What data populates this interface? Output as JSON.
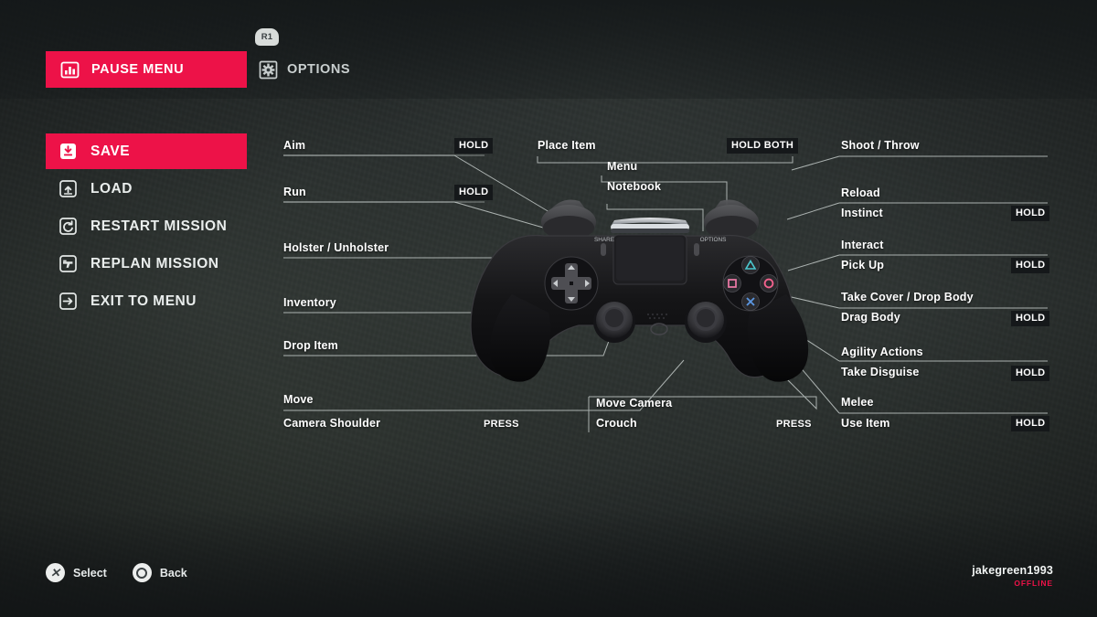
{
  "header": {
    "shoulder_badge": "R1",
    "tabs": [
      {
        "label": "PAUSE MENU",
        "icon": "chart-bars-icon",
        "active": true
      },
      {
        "label": "OPTIONS",
        "icon": "gear-icon",
        "active": false
      }
    ]
  },
  "sidebar": {
    "items": [
      {
        "label": "SAVE",
        "icon": "save-download-icon",
        "active": true
      },
      {
        "label": "LOAD",
        "icon": "load-upload-icon",
        "active": false
      },
      {
        "label": "RESTART MISSION",
        "icon": "restart-arrow-icon",
        "active": false
      },
      {
        "label": "REPLAN MISSION",
        "icon": "pistol-icon",
        "active": false
      },
      {
        "label": "EXIT TO MENU",
        "icon": "exit-arrow-icon",
        "active": false
      }
    ]
  },
  "controls": {
    "left": [
      {
        "label": "Aim",
        "tag": "HOLD",
        "tag_style": "box"
      },
      {
        "label": "Run",
        "tag": "HOLD",
        "tag_style": "box"
      },
      {
        "label": "Holster / Unholster",
        "tag": "",
        "tag_style": "none"
      },
      {
        "label": "Inventory",
        "tag": "",
        "tag_style": "none"
      },
      {
        "label": "Drop Item",
        "tag": "",
        "tag_style": "none"
      },
      {
        "label": "Move",
        "tag": "",
        "tag_style": "none"
      },
      {
        "label": "Camera Shoulder",
        "tag": "PRESS",
        "tag_style": "plain"
      }
    ],
    "center": [
      {
        "label": "Place Item",
        "tag": "HOLD BOTH",
        "tag_style": "box"
      },
      {
        "label": "Menu",
        "tag": "",
        "tag_style": "none"
      },
      {
        "label": "Notebook",
        "tag": "",
        "tag_style": "none"
      },
      {
        "label": "Move Camera",
        "tag": "",
        "tag_style": "none"
      },
      {
        "label": "Crouch",
        "tag": "PRESS",
        "tag_style": "plain"
      }
    ],
    "right": [
      {
        "label": "Shoot / Throw",
        "tag": "",
        "tag_style": "none"
      },
      {
        "label": "Reload",
        "tag": "",
        "tag_style": "none"
      },
      {
        "label": "Instinct",
        "tag": "HOLD",
        "tag_style": "box"
      },
      {
        "label": "Interact",
        "tag": "",
        "tag_style": "none"
      },
      {
        "label": "Pick Up",
        "tag": "HOLD",
        "tag_style": "box"
      },
      {
        "label": "Take Cover / Drop Body",
        "tag": "",
        "tag_style": "none"
      },
      {
        "label": "Drag Body",
        "tag": "HOLD",
        "tag_style": "box"
      },
      {
        "label": "Agility Actions",
        "tag": "",
        "tag_style": "none"
      },
      {
        "label": "Take Disguise",
        "tag": "HOLD",
        "tag_style": "box"
      },
      {
        "label": "Melee",
        "tag": "",
        "tag_style": "none"
      },
      {
        "label": "Use Item",
        "tag": "HOLD",
        "tag_style": "box"
      }
    ]
  },
  "gamepad": {
    "share_label": "SHARE",
    "options_label": "OPTIONS",
    "buttons": {
      "triangle_color": "#4bc8cf",
      "circle_color": "#f2628d",
      "square_color": "#f07ba8",
      "cross_color": "#5b96e0"
    }
  },
  "footer": {
    "hints": [
      {
        "label": "Select",
        "icon": "cross-button-icon"
      },
      {
        "label": "Back",
        "icon": "circle-button-icon"
      }
    ],
    "user": {
      "name": "jakegreen1993",
      "status": "OFFLINE",
      "status_color": "#ED1248"
    }
  }
}
